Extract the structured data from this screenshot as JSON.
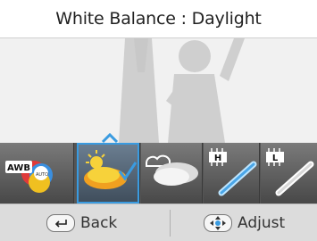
{
  "title": {
    "prefix": "White Balance",
    "separator": " : ",
    "value": "Daylight"
  },
  "white_balance": {
    "options": [
      {
        "id": "auto",
        "icon": "awb-icon",
        "text": "AWB",
        "subtext": "AUTO"
      },
      {
        "id": "daylight",
        "icon": "sun-icon",
        "selected": true
      },
      {
        "id": "cloudy",
        "icon": "cloud-icon"
      },
      {
        "id": "fluorescent_h",
        "icon": "fluorescent-h-icon",
        "text": "H"
      },
      {
        "id": "fluorescent_l",
        "icon": "fluorescent-l-icon",
        "text": "L"
      }
    ]
  },
  "bottom_bar": {
    "back_label": "Back",
    "adjust_label": "Adjust"
  },
  "colors": {
    "selection": "#3a9be0",
    "title_bg": "#ffffff",
    "strip_bg": "#555555"
  }
}
